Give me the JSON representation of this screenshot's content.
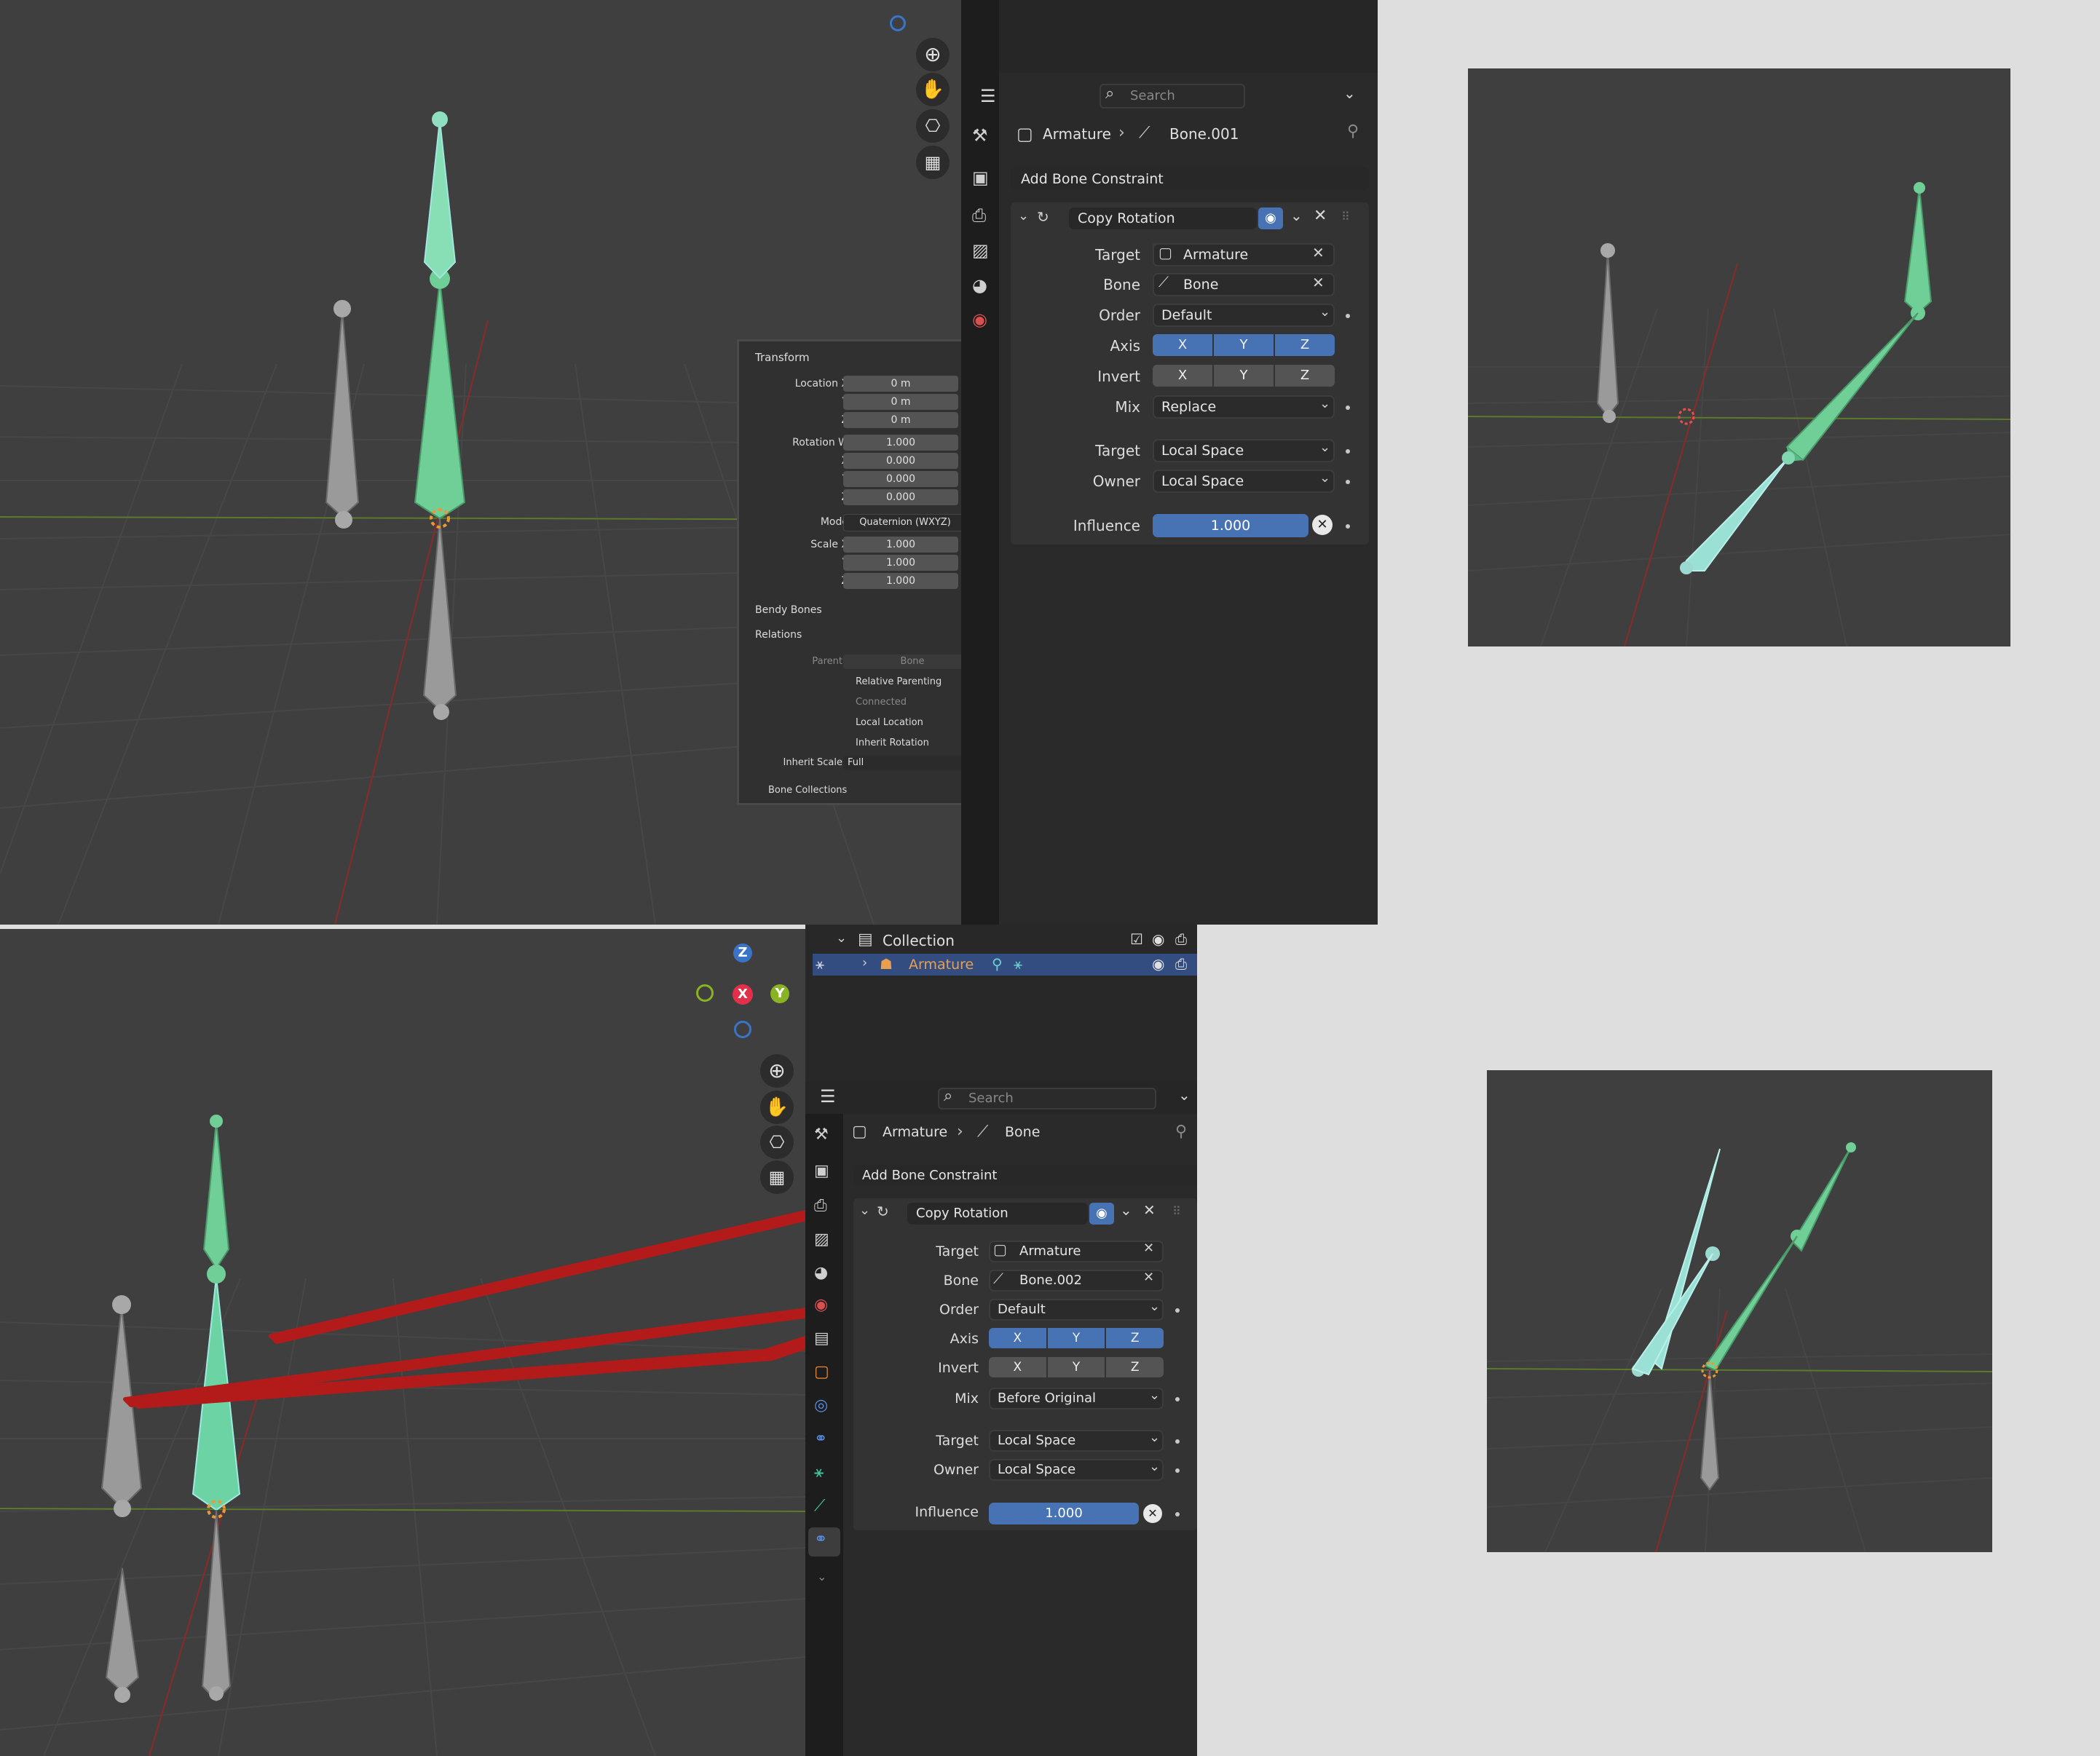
{
  "top_properties": {
    "search_placeholder": "Search",
    "breadcrumb_object": "Armature",
    "breadcrumb_bone": "Bone.001",
    "add_constraint": "Add Bone Constraint",
    "constraint_name": "Copy Rotation",
    "target_label": "Target",
    "target_value": "Armature",
    "bone_label": "Bone",
    "bone_value": "Bone",
    "order_label": "Order",
    "order_value": "Default",
    "axis_label": "Axis",
    "axis_x": "X",
    "axis_y": "Y",
    "axis_z": "Z",
    "invert_label": "Invert",
    "mix_label": "Mix",
    "mix_value": "Replace",
    "target_space_label": "Target",
    "target_space_value": "Local Space",
    "owner_label": "Owner",
    "owner_value": "Local Space",
    "influence_label": "Influence",
    "influence_value": "1.000",
    "influence_fraction": 1.0
  },
  "n_panel": {
    "transform_header": "Transform",
    "location_x_label": "Location X",
    "loc_x": "0 m",
    "y_label": "Y",
    "loc_y": "0 m",
    "z_label": "Z",
    "loc_z": "0 m",
    "rotation_w_label": "Rotation W",
    "rot_w": "1.000",
    "x_label": "X",
    "rot_x": "0.000",
    "rot_y": "0.000",
    "rot_z": "0.000",
    "mode_label": "Mode",
    "mode_value": "Quaternion (WXYZ)",
    "scale_x_label": "Scale X",
    "scale_x": "1.000",
    "scale_y": "1.000",
    "scale_z": "1.000",
    "bendy_header": "Bendy Bones",
    "relations_header": "Relations",
    "parent_label": "Parent",
    "parent_value": "Bone",
    "relative_parenting": "Relative Parenting",
    "connected": "Connected",
    "local_location": "Local Location",
    "inherit_rotation": "Inherit Rotation",
    "inherit_scale_label": "Inherit Scale",
    "inherit_scale_value": "Full",
    "collections_header": "Bone Collections"
  },
  "outliner": {
    "collection": "Collection",
    "armature": "Armature"
  },
  "bottom_properties": {
    "search_placeholder": "Search",
    "breadcrumb_object": "Armature",
    "breadcrumb_bone": "Bone",
    "add_constraint": "Add Bone Constraint",
    "constraint_name": "Copy Rotation",
    "target_label": "Target",
    "target_value": "Armature",
    "bone_label": "Bone",
    "bone_value": "Bone.002",
    "order_label": "Order",
    "order_value": "Default",
    "axis_label": "Axis",
    "axis_x": "X",
    "axis_y": "Y",
    "axis_z": "Z",
    "invert_label": "Invert",
    "mix_label": "Mix",
    "mix_value": "Before Original",
    "target_space_label": "Target",
    "target_space_value": "Local Space",
    "owner_label": "Owner",
    "owner_value": "Local Space",
    "influence_label": "Influence",
    "influence_value": "1.000",
    "influence_fraction": 1.0
  },
  "gizmo": {
    "z": "Z",
    "x": "X",
    "y": "Y"
  },
  "colors": {
    "accent": "#4772b3",
    "bone_selected": "#6fcf97",
    "bone_gray": "#a8a8a8",
    "annotation_red": "#b31b1b",
    "armature_name": "#e8a050"
  }
}
